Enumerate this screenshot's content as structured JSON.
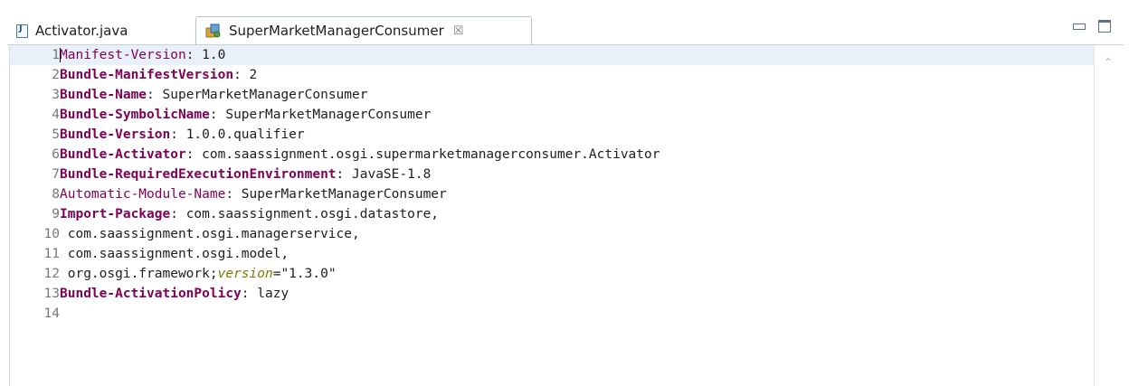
{
  "tabs": [
    {
      "label": "Activator.java",
      "icon": "java-file-icon",
      "active": false
    },
    {
      "label": "SuperMarketManagerConsumer",
      "icon": "plugin-manifest-icon",
      "active": true,
      "close": "☒"
    }
  ],
  "window_controls": {
    "minimize": "minimize-icon",
    "maximize": "maximize-icon"
  },
  "editor": {
    "lines": [
      {
        "n": "1",
        "key": "Manifest-Version",
        "sep": ": ",
        "val": "1.0",
        "style": "plain"
      },
      {
        "n": "2",
        "key": "Bundle-ManifestVersion",
        "sep": ": ",
        "val": "2",
        "style": "bold"
      },
      {
        "n": "3",
        "key": "Bundle-Name",
        "sep": ": ",
        "val": "SuperMarketManagerConsumer",
        "style": "bold"
      },
      {
        "n": "4",
        "key": "Bundle-SymbolicName",
        "sep": ": ",
        "val": "SuperMarketManagerConsumer",
        "style": "bold"
      },
      {
        "n": "5",
        "key": "Bundle-Version",
        "sep": ": ",
        "val": "1.0.0.qualifier",
        "style": "bold"
      },
      {
        "n": "6",
        "key": "Bundle-Activator",
        "sep": ": ",
        "val": "com.saassignment.osgi.supermarketmanagerconsumer.Activator",
        "style": "bold"
      },
      {
        "n": "7",
        "key": "Bundle-RequiredExecutionEnvironment",
        "sep": ": ",
        "val": "JavaSE-1.8",
        "style": "bold"
      },
      {
        "n": "8",
        "key": "Automatic-Module-Name",
        "sep": ": ",
        "val": "SuperMarketManagerConsumer",
        "style": "plain"
      },
      {
        "n": "9",
        "key": "Import-Package",
        "sep": ": ",
        "val": "com.saassignment.osgi.datastore,",
        "style": "bold"
      },
      {
        "n": "10",
        "key": "",
        "sep": "",
        "val": " com.saassignment.osgi.managerservice,",
        "style": "none"
      },
      {
        "n": "11",
        "key": "",
        "sep": "",
        "val": " com.saassignment.osgi.model,",
        "style": "none"
      },
      {
        "n": "12",
        "key": "",
        "sep": "",
        "val": " org.osgi.framework;",
        "attr": "version",
        "attr_val": "=\"1.3.0\"",
        "style": "none"
      },
      {
        "n": "13",
        "key": "Bundle-ActivationPolicy",
        "sep": ": ",
        "val": "lazy",
        "style": "bold"
      },
      {
        "n": "14",
        "key": "",
        "sep": "",
        "val": "",
        "style": "none"
      }
    ]
  },
  "colors": {
    "keyword": "#7f0055",
    "attribute": "#7c7c00",
    "current_line": "#e8f0fa",
    "line_number": "#787878"
  }
}
